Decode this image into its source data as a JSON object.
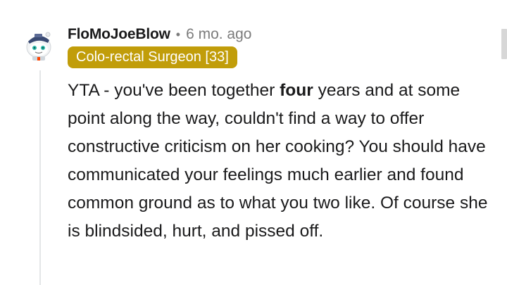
{
  "comment": {
    "username": "FloMoJoeBlow",
    "separator": "•",
    "age": "6 mo. ago",
    "flair": "Colo-rectal Surgeon [33]",
    "flair_color": "#c19d0a",
    "avatar_icon": "snoo-avatar-with-cap-icon",
    "body": {
      "text_before_bold": "YTA - you've been together ",
      "bold_text": "four",
      "text_after_bold": " years and at some point along the way, couldn't find a way to offer constructive criticism on her cooking? You should have communicated your feelings much earlier and found common ground as to what you two like. Of course she is blindsided, hurt, and pissed off."
    }
  }
}
